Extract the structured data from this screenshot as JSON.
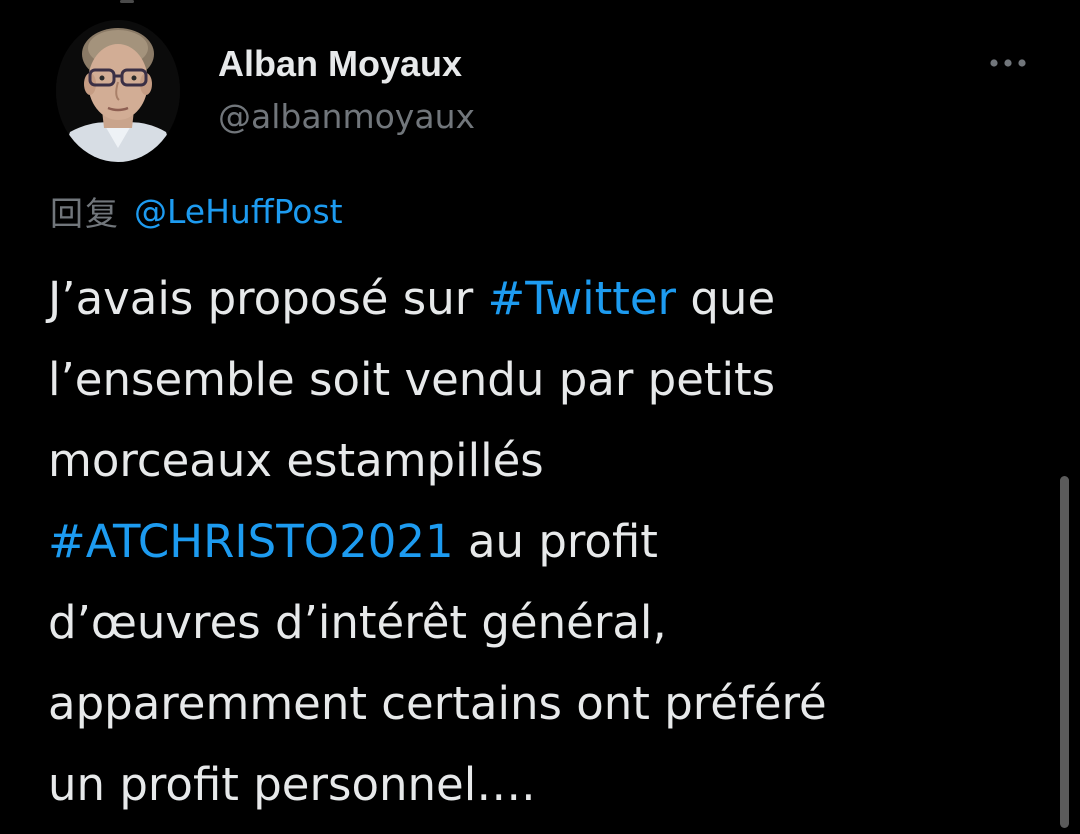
{
  "colors": {
    "background": "#000000",
    "text_primary": "#e7e9ea",
    "text_secondary": "#71767b",
    "accent_link": "#1d9bf0"
  },
  "tweet": {
    "author": {
      "name": "Alban Moyaux",
      "handle": "@albanmoyaux"
    },
    "more_icon": "more-horizontal-icon",
    "reply": {
      "prefix": "回复",
      "mention": "@LeHuffPost"
    },
    "text_lines": [
      {
        "before": "J’avais proposé sur ",
        "hashtag": "#Twitter",
        "after": " que"
      },
      {
        "text": "l’ensemble soit vendu par petits"
      },
      {
        "text": "morceaux estampillés"
      },
      {
        "hashtag": "#ATCHRISTO2021",
        "after": " au profit"
      },
      {
        "text": "d’œuvres d’intérêt général,"
      },
      {
        "text": "apparemment certains ont préféré"
      },
      {
        "text": "un profit personnel…."
      }
    ]
  }
}
